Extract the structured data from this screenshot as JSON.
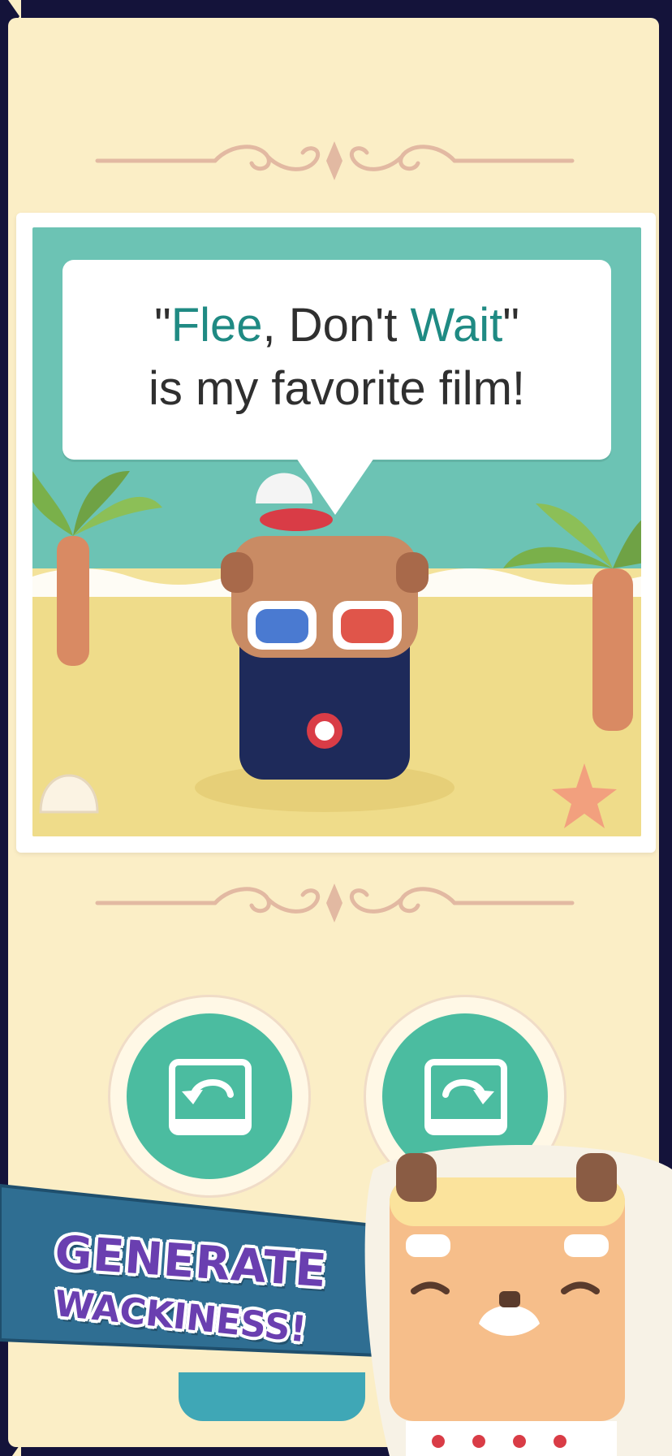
{
  "colors": {
    "frame": "#14133a",
    "paper": "#fbeec6",
    "teal_text": "#1f8a83",
    "button": "#4bbca0",
    "banner_purple": "#6a3fb0",
    "banner_blue": "#2f6e92"
  },
  "speech_bubble": {
    "quote_open": "\"",
    "word1": "Flee",
    "sep": ", Don't ",
    "word2": "Wait",
    "quote_close": "\"",
    "line2": "is my favorite film!"
  },
  "controls": {
    "rotate_left_icon": "rotate-counterclockwise-icon",
    "rotate_right_icon": "rotate-clockwise-icon"
  },
  "promo_banner": {
    "line1": "GENERATE",
    "line2": "WACKINESS!"
  }
}
